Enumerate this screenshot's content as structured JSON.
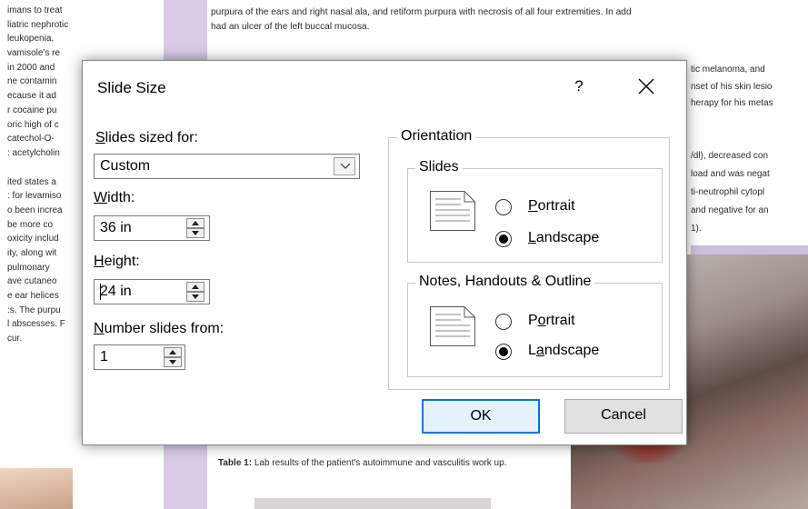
{
  "background": {
    "left_column_lines": [
      "imans to treat",
      "liatric nephrotic",
      "leukopenia,",
      "vamisole's re",
      "in 2000 and",
      "ne contamin",
      "ecause it ad",
      "r cocaine pu",
      "oric high of c",
      "catechol-O-",
      ": acetylcholin",
      "",
      "ited states a",
      ": for levamiso",
      "o been increa",
      "be more co",
      "oxicity includ",
      "ity, along wit",
      "pulmonary",
      "ave cutaneo",
      "e ear helices",
      ":s. The purpu",
      "l abscesses. F",
      "cur."
    ],
    "top_lines": [
      "purpura of the ears and right nasal ala, and retiform purpura with necrosis of all four extremities. In add",
      "had an ulcer of the left buccal mucosa."
    ],
    "right_lines_a": [
      "tic melanoma, and",
      "nset of his skin lesio",
      "herapy for his metas"
    ],
    "right_lines_b": [
      "/dl), decreased con",
      "load and was negat",
      "ti-neutrophil cytopl",
      "and negative for an",
      "1)."
    ],
    "caption_bold": "Table 1:",
    "caption_rest": " Lab results of the patient's autoimmune and vasculitis work up."
  },
  "dialog": {
    "title": "Slide Size",
    "help_label": "?",
    "slides_sized_for": {
      "prefix": "",
      "accel": "S",
      "rest": "lides sized for:"
    },
    "size_value": "Custom",
    "width_label": {
      "prefix": "",
      "accel": "W",
      "rest": "idth:"
    },
    "width_value": "36 in",
    "height_label": {
      "prefix": "",
      "accel": "H",
      "rest": "eight:"
    },
    "height_value": "24 in",
    "number_label": {
      "prefix": "",
      "accel": "N",
      "rest": "umber slides from:"
    },
    "number_value": "1",
    "orientation_title": "Orientation",
    "slides_group": {
      "title": "Slides",
      "portrait": {
        "prefix": "",
        "accel": "P",
        "rest": "ortrait",
        "selected": false
      },
      "landscape": {
        "prefix": "",
        "accel": "L",
        "rest": "andscape",
        "selected": true
      }
    },
    "notes_group": {
      "title": "Notes, Handouts & Outline",
      "portrait": {
        "prefix": "P",
        "accel": "o",
        "rest": "rtrait",
        "selected": false
      },
      "landscape": {
        "prefix": "L",
        "accel": "a",
        "rest": "ndscape",
        "selected": true
      }
    },
    "ok_label": "OK",
    "cancel_label": "Cancel"
  },
  "colors": {
    "accent": "#0078d7",
    "strip": "#d9cbe6"
  }
}
